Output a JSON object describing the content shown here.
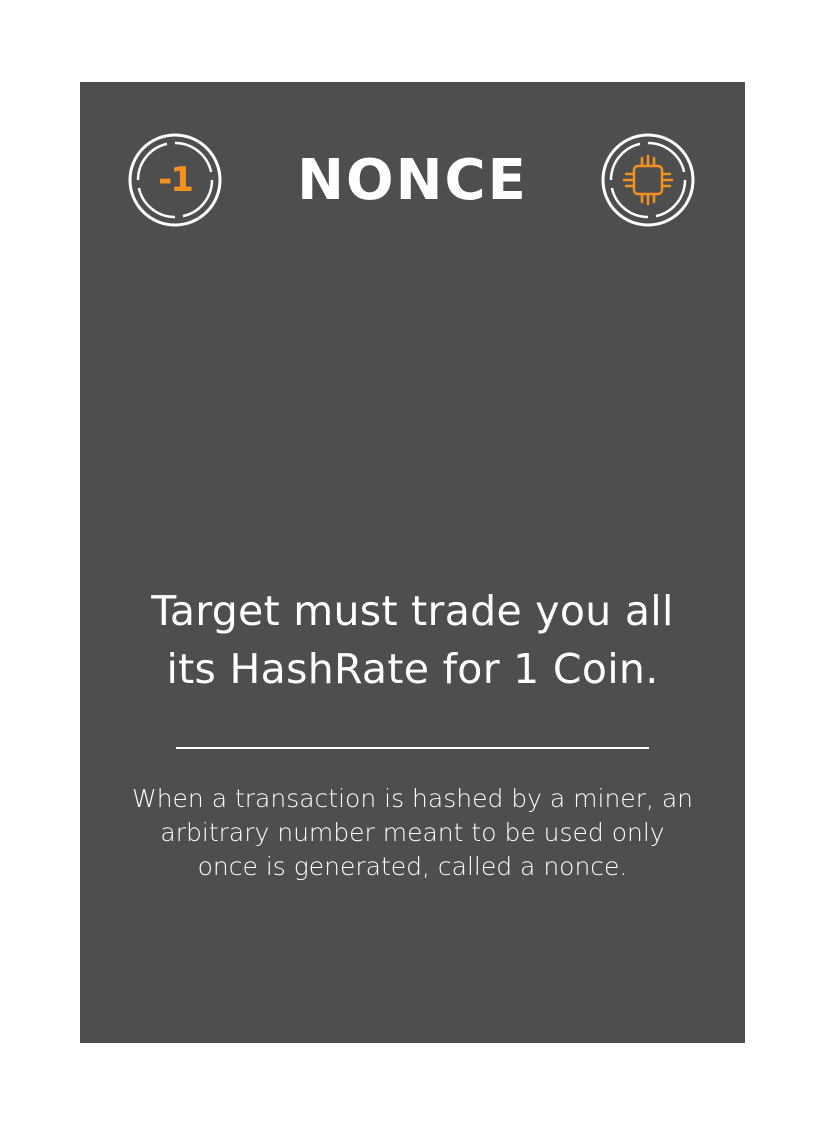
{
  "card": {
    "cost": "-1",
    "cost_icon": "circle-badge-icon",
    "type_icon": "cpu-chip-icon",
    "title": "NONCE",
    "effect_line1": "Target must trade you all",
    "effect_line2": "its HashRate for 1 Coin.",
    "flavor_line1": "When a transaction is hashed by a miner, an",
    "flavor_line2": "arbitrary number meant to be used only",
    "flavor_line3": "once is generated, called a nonce."
  },
  "colors": {
    "card_background": "#4e4e4e",
    "page_background": "#ffffff",
    "accent": "#f5911e",
    "text": "#ffffff"
  }
}
